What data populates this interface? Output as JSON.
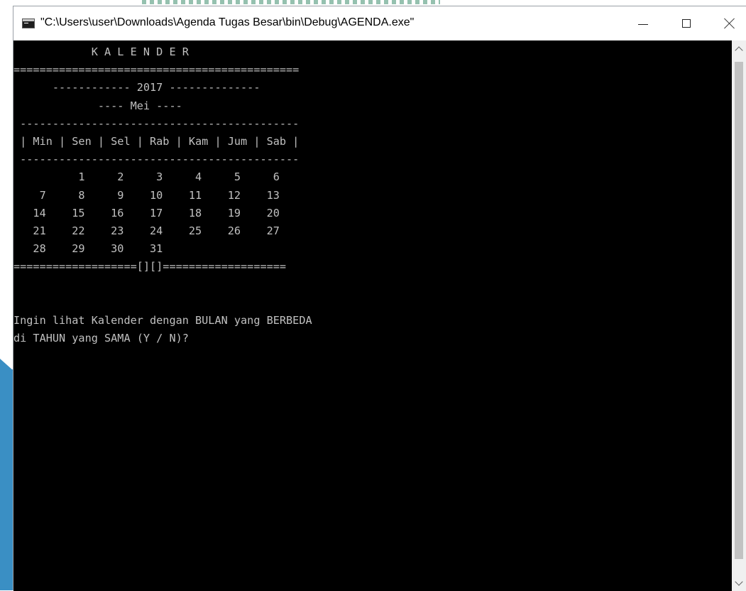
{
  "window": {
    "title": "\"C:\\Users\\user\\Downloads\\Agenda Tugas Besar\\bin\\Debug\\AGENDA.exe\"",
    "icon": "console-app-icon",
    "controls": {
      "minimize": "minimize-icon",
      "maximize": "maximize-icon",
      "close": "close-icon"
    }
  },
  "console": {
    "colors": {
      "background": "#000000",
      "text": "#c0c0c0"
    },
    "lines": [
      "            K A L E N D E R",
      "============================================",
      "      ------------ 2017 --------------",
      "             ---- Mei ----",
      " -------------------------------------------",
      " | Min | Sen | Sel | Rab | Kam | Jum | Sab |",
      " -------------------------------------------",
      "          1     2     3     4     5     6",
      "    7     8     9    10    11    12    13",
      "   14    15    16    17    18    19    20",
      "   21    22    23    24    25    26    27",
      "   28    29    30    31",
      "===================[][]===================",
      "",
      "",
      "Ingin lihat Kalender dengan BULAN yang BERBEDA",
      "di TAHUN yang SAMA (Y / N)?"
    ]
  }
}
